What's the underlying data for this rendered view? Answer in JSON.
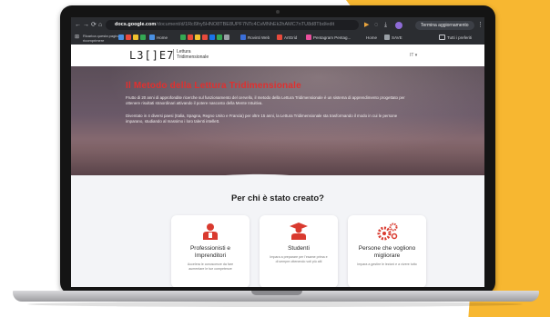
{
  "colors": {
    "accent": "#f7b731",
    "brand_red": "#e0302f",
    "chrome": "#2b2d31"
  },
  "browser": {
    "url_domain": "docs.google.com",
    "url_path": "/document/d/1Rcl9hy5HNO8TBE8UPF7NTc4CvMNhEk2hAMC7nTU8d8Tbd/edit",
    "update_button": "Termina aggiornamento",
    "bookmarks_label_line1": "Ricarica questa pagina",
    "bookmarks_label_line2": "ricomprimere",
    "bookmarks": [
      {
        "label": "Home",
        "color": "#4a90e2"
      },
      {
        "label": "Rovinti Web",
        "color": "#3b6fd8"
      },
      {
        "label": "ArtGrid",
        "color": "#e84a3c"
      },
      {
        "label": "Pentagram Pentag...",
        "color": "#e94f9c"
      },
      {
        "label": "Home",
        "color": "#9aa0a6"
      },
      {
        "label": "SAVE",
        "color": "#9aa0a6"
      }
    ],
    "all_bookmarks": "Tutti i preferiti"
  },
  "site": {
    "logo": "L3[]E7",
    "logo_tag_line1": "Lettura",
    "logo_tag_line2": "Tridimensionale",
    "lang": "IT ▾"
  },
  "hero": {
    "title": "Il Metodo della Lettura Tridimensionale",
    "p1": "Frutto di 20 anni di approfondite ricerche sul funzionamento del cervello, il metodo della Lettura Tridimensionale è un sistema di apprendimento progettato per ottenere risultati straordinari attivando il potere nascosto della Mente Intuitiva.",
    "p2": "Diventato in 4 diversi paesi (Italia, Spagna, Regno Unito e Francia) per oltre 15 anni, la Lettura Tridimensionale sta trasformando il modo in cui le persone imparano, studiando al massimo i loro talenti intellett."
  },
  "main": {
    "section_title": "Per chi è stato creato?",
    "cards": [
      {
        "title": "Professionisti e Imprenditori",
        "text": "Accelera le conoscenze da fare aumentare le tue competenze",
        "icon": "professional-icon"
      },
      {
        "title": "Studenti",
        "text": "Impara a preparare per l'esame prima e di sempre ottenendo voti più alti",
        "icon": "graduate-icon"
      },
      {
        "title": "Persone che vogliono migliorare",
        "text": "Impara a gestire le lezioni e a vivere tutto",
        "icon": "gears-icon"
      }
    ]
  }
}
